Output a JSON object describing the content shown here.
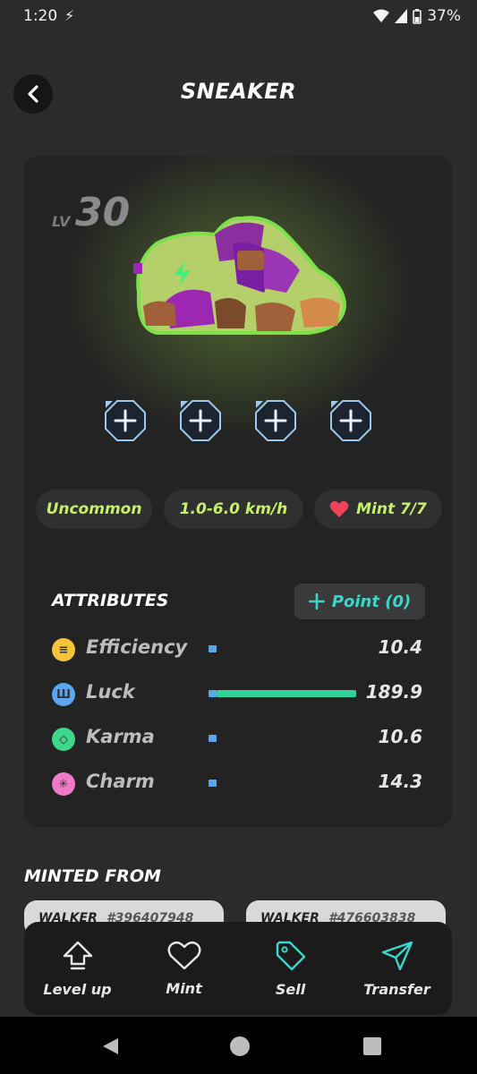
{
  "status_bar": {
    "time": "1:20",
    "battery": "37%"
  },
  "header": {
    "title": "SNEAKER"
  },
  "sneaker": {
    "level_label": "LV",
    "level": "30",
    "socket_count": 4,
    "chips": {
      "rarity": "Uncommon",
      "speed": "1.0-6.0 km/h",
      "mint": "Mint 7/7"
    }
  },
  "attributes": {
    "title": "ATTRIBUTES",
    "point_button": "Point (0)",
    "items": [
      {
        "name": "Efficiency",
        "value": "10.4",
        "color": "#f5c33b",
        "fill": 0.05
      },
      {
        "name": "Luck",
        "value": "189.9",
        "color": "#5aa6f0",
        "fill": 1.0
      },
      {
        "name": "Karma",
        "value": "10.6",
        "color": "#3ed68a",
        "fill": 0.05
      },
      {
        "name": "Charm",
        "value": "14.3",
        "color": "#f07ac8",
        "fill": 0.07
      }
    ]
  },
  "minted_from": {
    "title": "MINTED FROM",
    "walkers": [
      {
        "label": "WALKER",
        "id": "#396407948"
      },
      {
        "label": "WALKER",
        "id": "#476603838"
      }
    ]
  },
  "actions": [
    {
      "label": "Level up",
      "icon": "arrow-up-icon"
    },
    {
      "label": "Mint",
      "icon": "heart-icon"
    },
    {
      "label": "Sell",
      "icon": "tag-icon"
    },
    {
      "label": "Transfer",
      "icon": "send-icon"
    }
  ],
  "colors": {
    "accent_green": "#c5f06a",
    "accent_teal": "#3ad6cc",
    "luck_bar": "#2fd39a"
  }
}
